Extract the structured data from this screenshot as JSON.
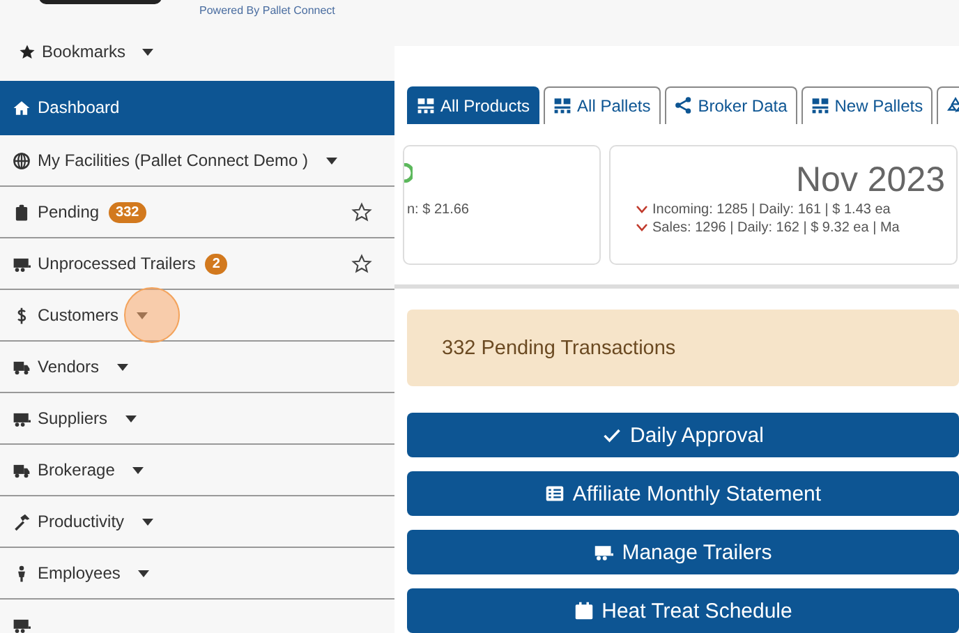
{
  "header": {
    "powered_by": "Powered By Pallet Connect"
  },
  "sidebar": {
    "bookmarks": "Bookmarks",
    "items": [
      {
        "label": "Dashboard",
        "kind": "link",
        "selected": true
      },
      {
        "label": "My Facilities (Pallet Connect Demo )",
        "kind": "dropdown",
        "selected": false
      },
      {
        "label": "Pending",
        "kind": "star",
        "badge": "332",
        "selected": false
      },
      {
        "label": "Unprocessed Trailers",
        "kind": "star",
        "badge": "2",
        "selected": false
      },
      {
        "label": "Customers",
        "kind": "dropdown",
        "selected": false
      },
      {
        "label": "Vendors",
        "kind": "dropdown",
        "selected": false
      },
      {
        "label": "Suppliers",
        "kind": "dropdown",
        "selected": false
      },
      {
        "label": "Brokerage",
        "kind": "dropdown",
        "selected": false
      },
      {
        "label": "Productivity",
        "kind": "dropdown",
        "selected": false
      },
      {
        "label": "Employees",
        "kind": "dropdown",
        "selected": false
      },
      {
        "kind": "link",
        "selected": false
      }
    ]
  },
  "tabs": [
    {
      "label": "All Products",
      "selected": true
    },
    {
      "label": "All Pallets",
      "selected": false
    },
    {
      "label": "Broker Data",
      "selected": false
    },
    {
      "label": "New Pallets",
      "selected": false
    },
    {
      "selected": false
    }
  ],
  "cards": [
    {
      "lines": [
        "n: $ 21.66"
      ]
    },
    {
      "title": "Nov 2023",
      "lines": [
        "Incoming: 1285 | Daily: 161 | $ 1.43 ea",
        "Sales: 1296 | Daily: 162 | $ 9.32 ea | Ma"
      ]
    }
  ],
  "alert": "332 Pending Transactions",
  "actions": [
    {
      "label": "Daily Approval"
    },
    {
      "label": "Affiliate Monthly Statement"
    },
    {
      "label": "Manage Trailers"
    },
    {
      "label": "Heat Treat Schedule"
    }
  ]
}
